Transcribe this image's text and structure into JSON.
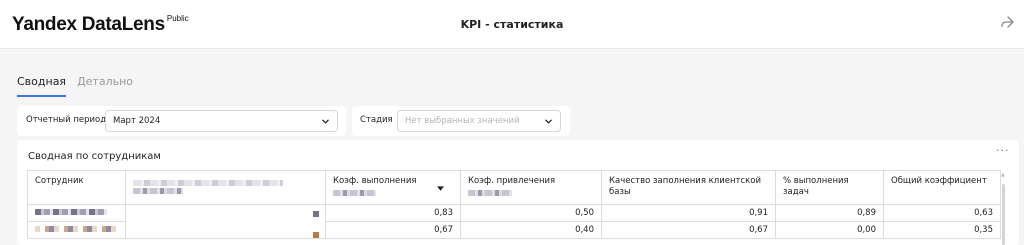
{
  "header": {
    "logo": "Yandex DataLens",
    "logo_badge": "Public",
    "title": "KPI - статистика",
    "share_icon": "share-icon"
  },
  "tabs": [
    {
      "label": "Сводная",
      "active": true
    },
    {
      "label": "Детально",
      "active": false
    }
  ],
  "filters": {
    "period": {
      "label": "Отчетный период",
      "value": "Март 2024"
    },
    "stage": {
      "label": "Стадия",
      "placeholder": "Нет выбранных значений"
    }
  },
  "panel": {
    "title": "Сводная по сотрудникам",
    "menu_label": "···",
    "columns": [
      {
        "label": "Сотрудник"
      },
      {
        "label": ""
      },
      {
        "label": "Коэф. выполнения"
      },
      {
        "label": "Коэф. привлечения"
      },
      {
        "label": "Качество заполнения клиентской базы"
      },
      {
        "label": "% выполнения задач"
      },
      {
        "label": "Общий коэффициент"
      }
    ],
    "rows": [
      {
        "vals": [
          "0,83",
          "0,50",
          "0,91",
          "0,89",
          "0,63"
        ],
        "swatch_color": "#7a7189"
      },
      {
        "vals": [
          "0,67",
          "0,40",
          "0,67",
          "0,00",
          "0,35"
        ],
        "swatch_color": "#b57b45"
      }
    ]
  },
  "colors": {
    "accent": "#3a78d5",
    "background": "#f5f5f5"
  }
}
